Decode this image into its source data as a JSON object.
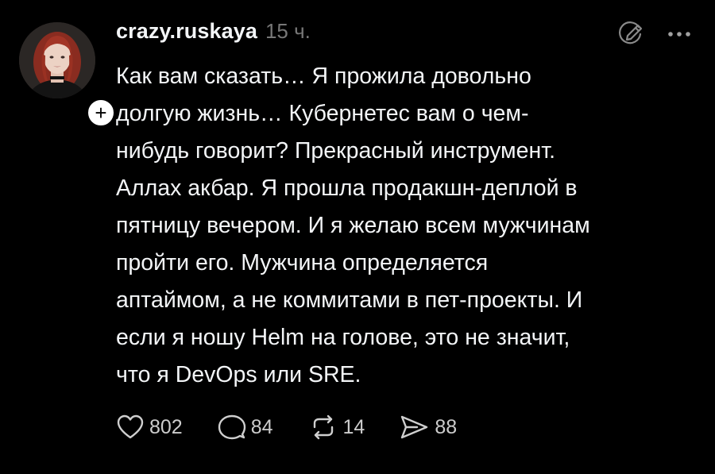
{
  "post": {
    "username": "crazy.ruskaya",
    "timestamp": "15 ч.",
    "text_lines": [
      "Как вам сказать… Я прожила довольно",
      "долгую жизнь… Кубернетес вам о чем-",
      "нибудь говорит? Прекрасный инструмент.",
      "Аллах акбар. Я прошла продакшн-деплой в",
      "пятницу вечером. И я желаю всем мужчинам",
      "пройти его. Мужчина определяется",
      "аптаймом, а не коммитами в пет-проекты. И",
      "если я ношу Helm на голове, это не значит,",
      "что я DevOps или SRE."
    ],
    "follow_symbol": "+"
  },
  "actions": {
    "likes": "802",
    "comments": "84",
    "reposts": "14",
    "shares": "88"
  },
  "icons": {
    "edit": "edit-pencil-circle-icon",
    "more": "more-dots-icon",
    "like": "heart-icon",
    "comment": "comment-bubble-icon",
    "repost": "repost-icon",
    "share": "share-send-icon"
  },
  "colors": {
    "background": "#000000",
    "text": "#f3f5f7",
    "muted": "#777777",
    "count": "#cccccc"
  }
}
